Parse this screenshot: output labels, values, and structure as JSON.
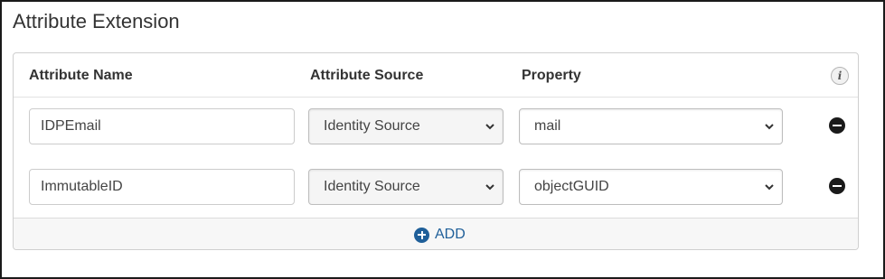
{
  "section": {
    "title": "Attribute Extension"
  },
  "table": {
    "headers": {
      "name": "Attribute Name",
      "source": "Attribute Source",
      "property": "Property"
    },
    "info_icon_glyph": "i",
    "rows": [
      {
        "name": "IDPEmail",
        "source": "Identity Source",
        "property": "mail"
      },
      {
        "name": "ImmutableID",
        "source": "Identity Source",
        "property": "objectGUID"
      }
    ],
    "add_label": "ADD"
  },
  "icons": {
    "info": "info-icon",
    "remove": "minus-circle-icon",
    "add": "plus-circle-icon",
    "dropdown": "chevron-down-icon"
  },
  "colors": {
    "accent": "#1f5f99",
    "remove_icon": "#1a1a1a"
  }
}
